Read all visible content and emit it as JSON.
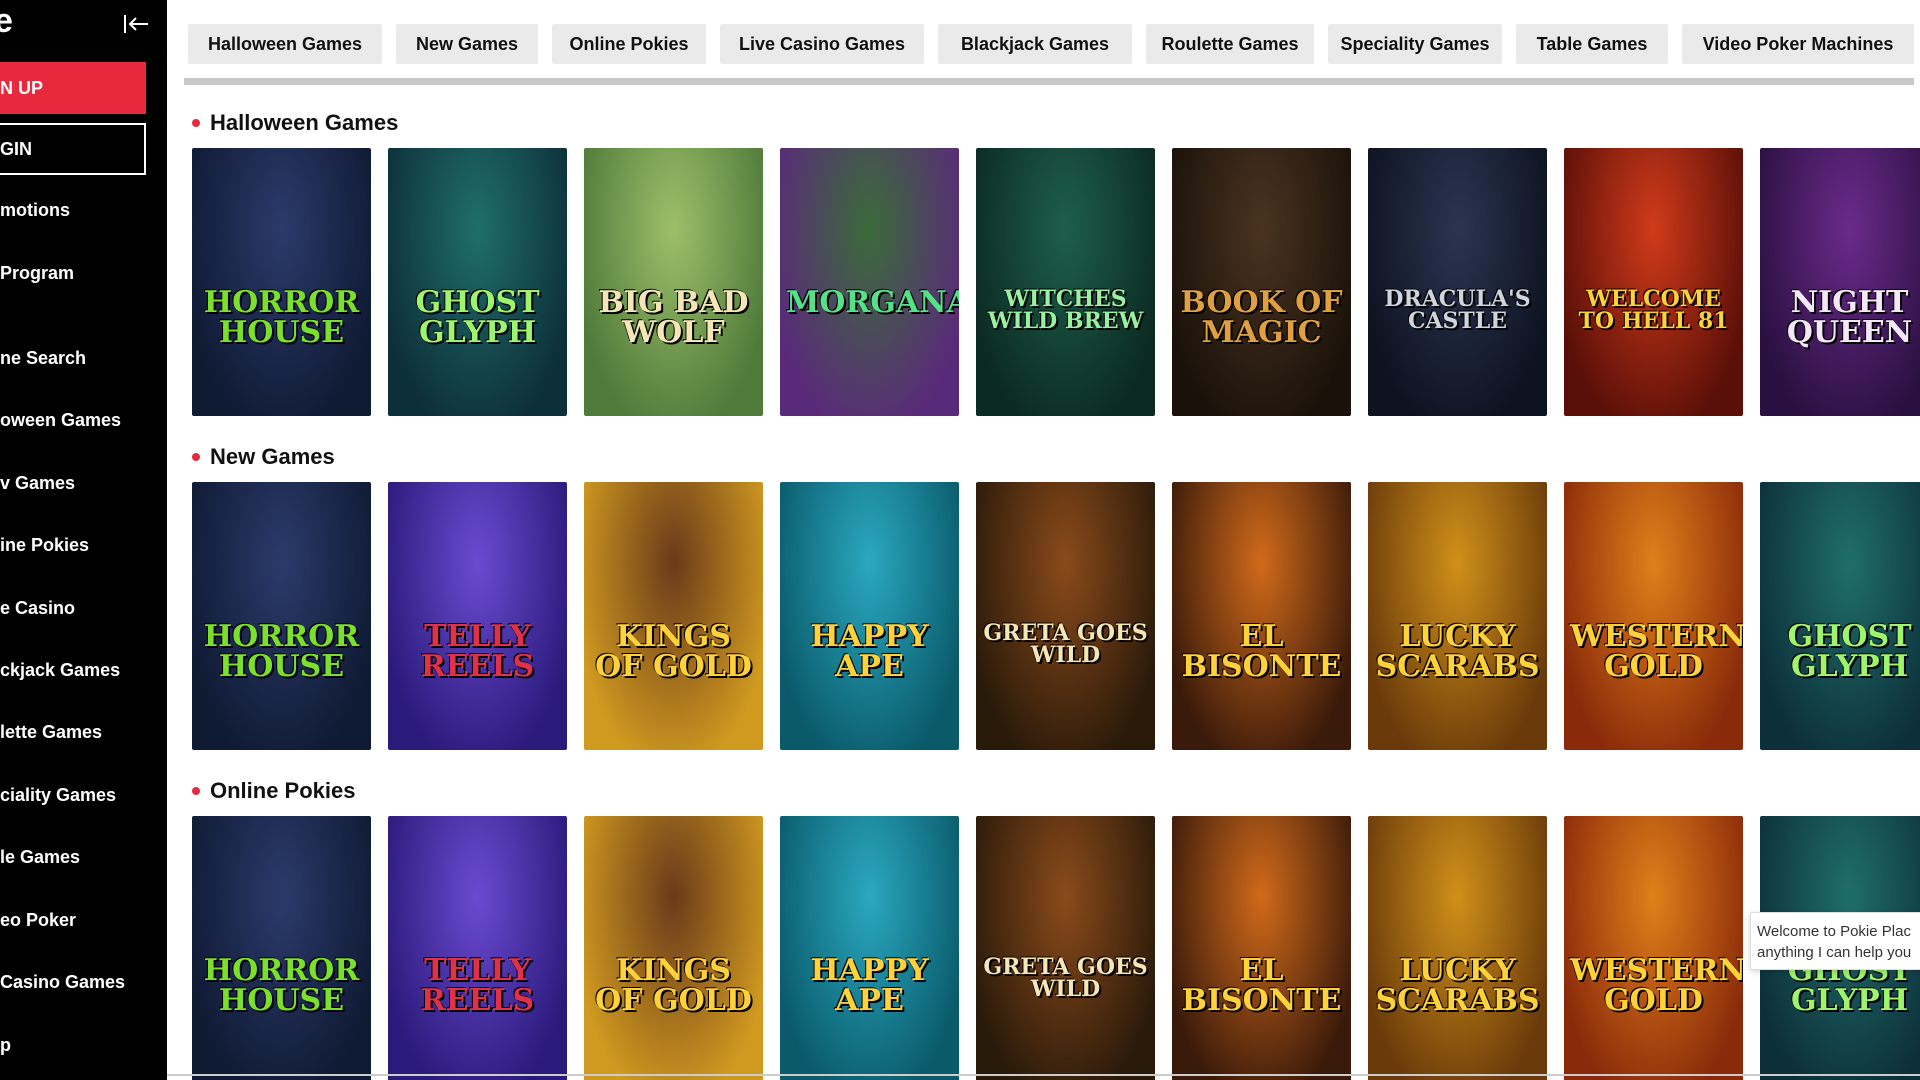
{
  "sidebar": {
    "logo_text": "e",
    "signup_label": "N UP",
    "login_label": "GIN",
    "items": [
      {
        "label": "motions"
      },
      {
        "label": " Program"
      },
      {
        "label": "ne Search"
      },
      {
        "label": "oween Games"
      },
      {
        "label": "v Games"
      },
      {
        "label": "ine Pokies"
      },
      {
        "label": "e Casino"
      },
      {
        "label": "ckjack Games"
      },
      {
        "label": "lette Games"
      },
      {
        "label": "ciality Games"
      },
      {
        "label": "le Games"
      },
      {
        "label": "eo Poker"
      },
      {
        "label": "Casino Games"
      },
      {
        "label": "p"
      }
    ]
  },
  "tabs": [
    {
      "label": "Halloween Games"
    },
    {
      "label": "New Games"
    },
    {
      "label": "Online Pokies"
    },
    {
      "label": "Live Casino Games"
    },
    {
      "label": "Blackjack Games"
    },
    {
      "label": "Roulette Games"
    },
    {
      "label": "Speciality Games"
    },
    {
      "label": "Table Games"
    },
    {
      "label": "Video Poker Machines"
    }
  ],
  "sections": [
    {
      "title": "Halloween Games",
      "games": [
        {
          "name": "HORROR HOUSE",
          "bg1": "#2b3a6b",
          "bg2": "#0f1a33",
          "fg": "#7be02b"
        },
        {
          "name": "GHOST GLYPH",
          "bg1": "#1f6e6a",
          "bg2": "#0d2f3a",
          "fg": "#9ef56b"
        },
        {
          "name": "BIG BAD WOLF",
          "bg1": "#9dbf6a",
          "bg2": "#4f7a3a",
          "fg": "#f4e6b5"
        },
        {
          "name": "MORGANA",
          "bg1": "#3b6b3a",
          "bg2": "#5a2a7a",
          "fg": "#55e08a"
        },
        {
          "name": "WITCHES WILD BREW",
          "bg1": "#1e5f4a",
          "bg2": "#0b2a22",
          "fg": "#9af0a0"
        },
        {
          "name": "BOOK OF MAGIC",
          "bg1": "#4a3320",
          "bg2": "#1a120a",
          "fg": "#e0a040"
        },
        {
          "name": "DRACULA'S CASTLE",
          "bg1": "#2a3550",
          "bg2": "#0d1220",
          "fg": "#d0d4dc"
        },
        {
          "name": "WELCOME TO HELL 81",
          "bg1": "#d03a1a",
          "bg2": "#5a0f08",
          "fg": "#ffd23a"
        },
        {
          "name": "NIGHT QUEEN",
          "bg1": "#6a2a8a",
          "bg2": "#2a1040",
          "fg": "#f4e8f8"
        }
      ]
    },
    {
      "title": "New Games",
      "games": [
        {
          "name": "HORROR HOUSE",
          "bg1": "#2b3a6b",
          "bg2": "#0f1a33",
          "fg": "#7be02b"
        },
        {
          "name": "TELLY REELS",
          "bg1": "#6a4ad0",
          "bg2": "#2a1a7a",
          "fg": "#e0314a"
        },
        {
          "name": "KINGS OF GOLD",
          "bg1": "#6a3a1a",
          "bg2": "#d09a20",
          "fg": "#ffd23a"
        },
        {
          "name": "HAPPY APE",
          "bg1": "#2aa8c0",
          "bg2": "#0a5a6a",
          "fg": "#ffd23a"
        },
        {
          "name": "GRETA GOES WILD",
          "bg1": "#8a4a1a",
          "bg2": "#2a1a0a",
          "fg": "#f4e6b5"
        },
        {
          "name": "EL BISONTE",
          "bg1": "#d06a1a",
          "bg2": "#3a1a0a",
          "fg": "#ffd23a"
        },
        {
          "name": "LUCKY SCARABS",
          "bg1": "#d0901a",
          "bg2": "#6a3a0a",
          "fg": "#ffd23a"
        },
        {
          "name": "WESTERN GOLD",
          "bg1": "#e0801a",
          "bg2": "#8a2a0a",
          "fg": "#ffd23a"
        },
        {
          "name": "GHOST GLYPH",
          "bg1": "#1f6e6a",
          "bg2": "#0d2f3a",
          "fg": "#9ef56b"
        }
      ]
    },
    {
      "title": "Online Pokies",
      "games": [
        {
          "name": "HORROR HOUSE",
          "bg1": "#2b3a6b",
          "bg2": "#0f1a33",
          "fg": "#7be02b"
        },
        {
          "name": "TELLY REELS",
          "bg1": "#6a4ad0",
          "bg2": "#2a1a7a",
          "fg": "#e0314a"
        },
        {
          "name": "KINGS OF GOLD",
          "bg1": "#6a3a1a",
          "bg2": "#d09a20",
          "fg": "#ffd23a"
        },
        {
          "name": "HAPPY APE",
          "bg1": "#2aa8c0",
          "bg2": "#0a5a6a",
          "fg": "#ffd23a"
        },
        {
          "name": "GRETA GOES WILD",
          "bg1": "#8a4a1a",
          "bg2": "#2a1a0a",
          "fg": "#f4e6b5"
        },
        {
          "name": "EL BISONTE",
          "bg1": "#d06a1a",
          "bg2": "#3a1a0a",
          "fg": "#ffd23a"
        },
        {
          "name": "LUCKY SCARABS",
          "bg1": "#d0901a",
          "bg2": "#6a3a0a",
          "fg": "#ffd23a"
        },
        {
          "name": "WESTERN GOLD",
          "bg1": "#e0801a",
          "bg2": "#8a2a0a",
          "fg": "#ffd23a"
        },
        {
          "name": "GHOST GLYPH",
          "bg1": "#1f6e6a",
          "bg2": "#0d2f3a",
          "fg": "#9ef56b"
        }
      ]
    }
  ],
  "chat": {
    "line1": "Welcome to Pokie Plac",
    "line2": "anything I can help you"
  },
  "colors": {
    "accent": "#e8293d",
    "sidebar_bg": "#000000",
    "tab_bg": "#eaeaea"
  },
  "icons": {
    "collapse": "collapse-sidebar-icon"
  }
}
